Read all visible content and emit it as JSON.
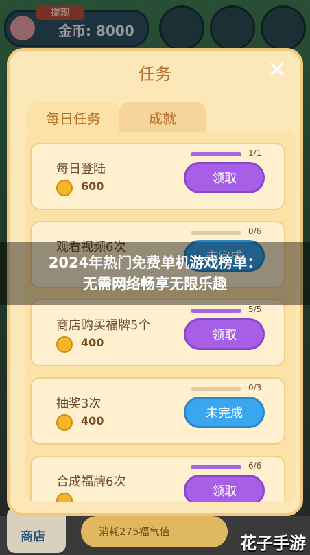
{
  "header": {
    "withdraw_tag": "提现",
    "coins_label": "金币: 8000"
  },
  "dialog": {
    "title": "任务",
    "close_icon": "close-icon",
    "tabs": [
      {
        "label": "每日任务",
        "active": true
      },
      {
        "label": "成就",
        "active": false
      }
    ]
  },
  "tasks": [
    {
      "name": "每日登陆",
      "reward": "600",
      "progress_text": "1/1",
      "progress": 1.0,
      "button": "领取",
      "state": "claim"
    },
    {
      "name": "观看视频6次",
      "reward": "",
      "progress_text": "0/6",
      "progress": 0.0,
      "button": "未完成",
      "state": "todo"
    },
    {
      "name": "商店购买福牌5个",
      "reward": "400",
      "progress_text": "5/5",
      "progress": 1.0,
      "button": "领取",
      "state": "claim"
    },
    {
      "name": "抽奖3次",
      "reward": "400",
      "progress_text": "0/3",
      "progress": 0.0,
      "button": "未完成",
      "state": "todo"
    },
    {
      "name": "合成福牌6次",
      "reward": "",
      "progress_text": "6/6",
      "progress": 1.0,
      "button": "领取",
      "state": "claim"
    }
  ],
  "banner": {
    "line1": "2024年热门免费单机游戏榜单：",
    "line2": "无需网络畅享无限乐趣"
  },
  "footer": {
    "shop_label": "商店",
    "consume_label": "消耗275福气值"
  },
  "watermark": "花子手游",
  "colors": {
    "claim": "#a75fe8",
    "todo": "#3aa6ef",
    "accent": "#b8702a"
  }
}
